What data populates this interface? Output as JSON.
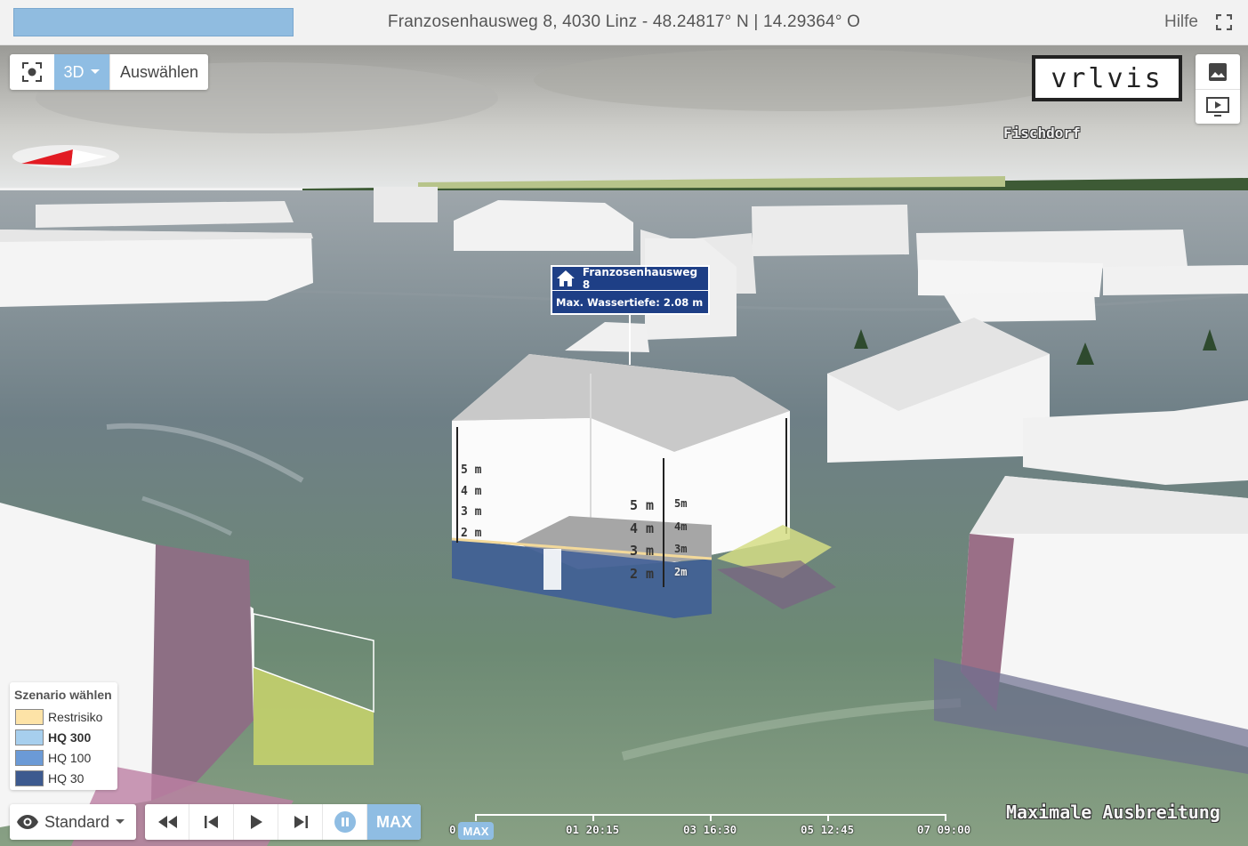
{
  "header": {
    "search_value": "",
    "address": "Franzosenhausweg 8, 4030 Linz - 48.24817° N | 14.29364° O",
    "help_label": "Hilfe",
    "fullscreen_icon": "fullscreen-icon"
  },
  "toolbar": {
    "focus_icon": "focus-target-icon",
    "mode_label": "3D",
    "select_label": "Auswählen"
  },
  "logo_text": "vrlvis",
  "side_buttons": [
    "image-icon",
    "play-screen-icon"
  ],
  "map": {
    "place_label": "Fischdorf",
    "popup": {
      "address": "Franzosenhausweg 8",
      "water_depth": "Max. Wassertiefe: 2.08 m"
    },
    "depth_scale_left": [
      "5 m",
      "4 m",
      "3 m",
      "2 m"
    ],
    "depth_scale_front": [
      "5 m",
      "4 m",
      "3 m",
      "2 m"
    ],
    "depth_scale_front_small": [
      "5m",
      "4m",
      "3m",
      "2m"
    ]
  },
  "legend": {
    "title": "Szenario wählen",
    "items": [
      {
        "label": "Restrisiko",
        "color": "#fde3a7",
        "selected": false
      },
      {
        "label": "HQ 300",
        "color": "#a7cfee",
        "selected": true
      },
      {
        "label": "HQ 100",
        "color": "#6b9ad6",
        "selected": false
      },
      {
        "label": "HQ 30",
        "color": "#3d5a8f",
        "selected": false
      }
    ]
  },
  "bottom": {
    "style_label": "Standard",
    "max_label": "MAX",
    "timeline_handle": "MAX",
    "timeline_ticks": [
      "0",
      "01 20:15",
      "03 16:30",
      "05 12:45",
      "07 09:00"
    ],
    "status": "Maximale Ausbreitung"
  },
  "colors": {
    "accent": "#8fbde3",
    "popup_bg": "#1e3f86",
    "water": "#6b8a72"
  }
}
